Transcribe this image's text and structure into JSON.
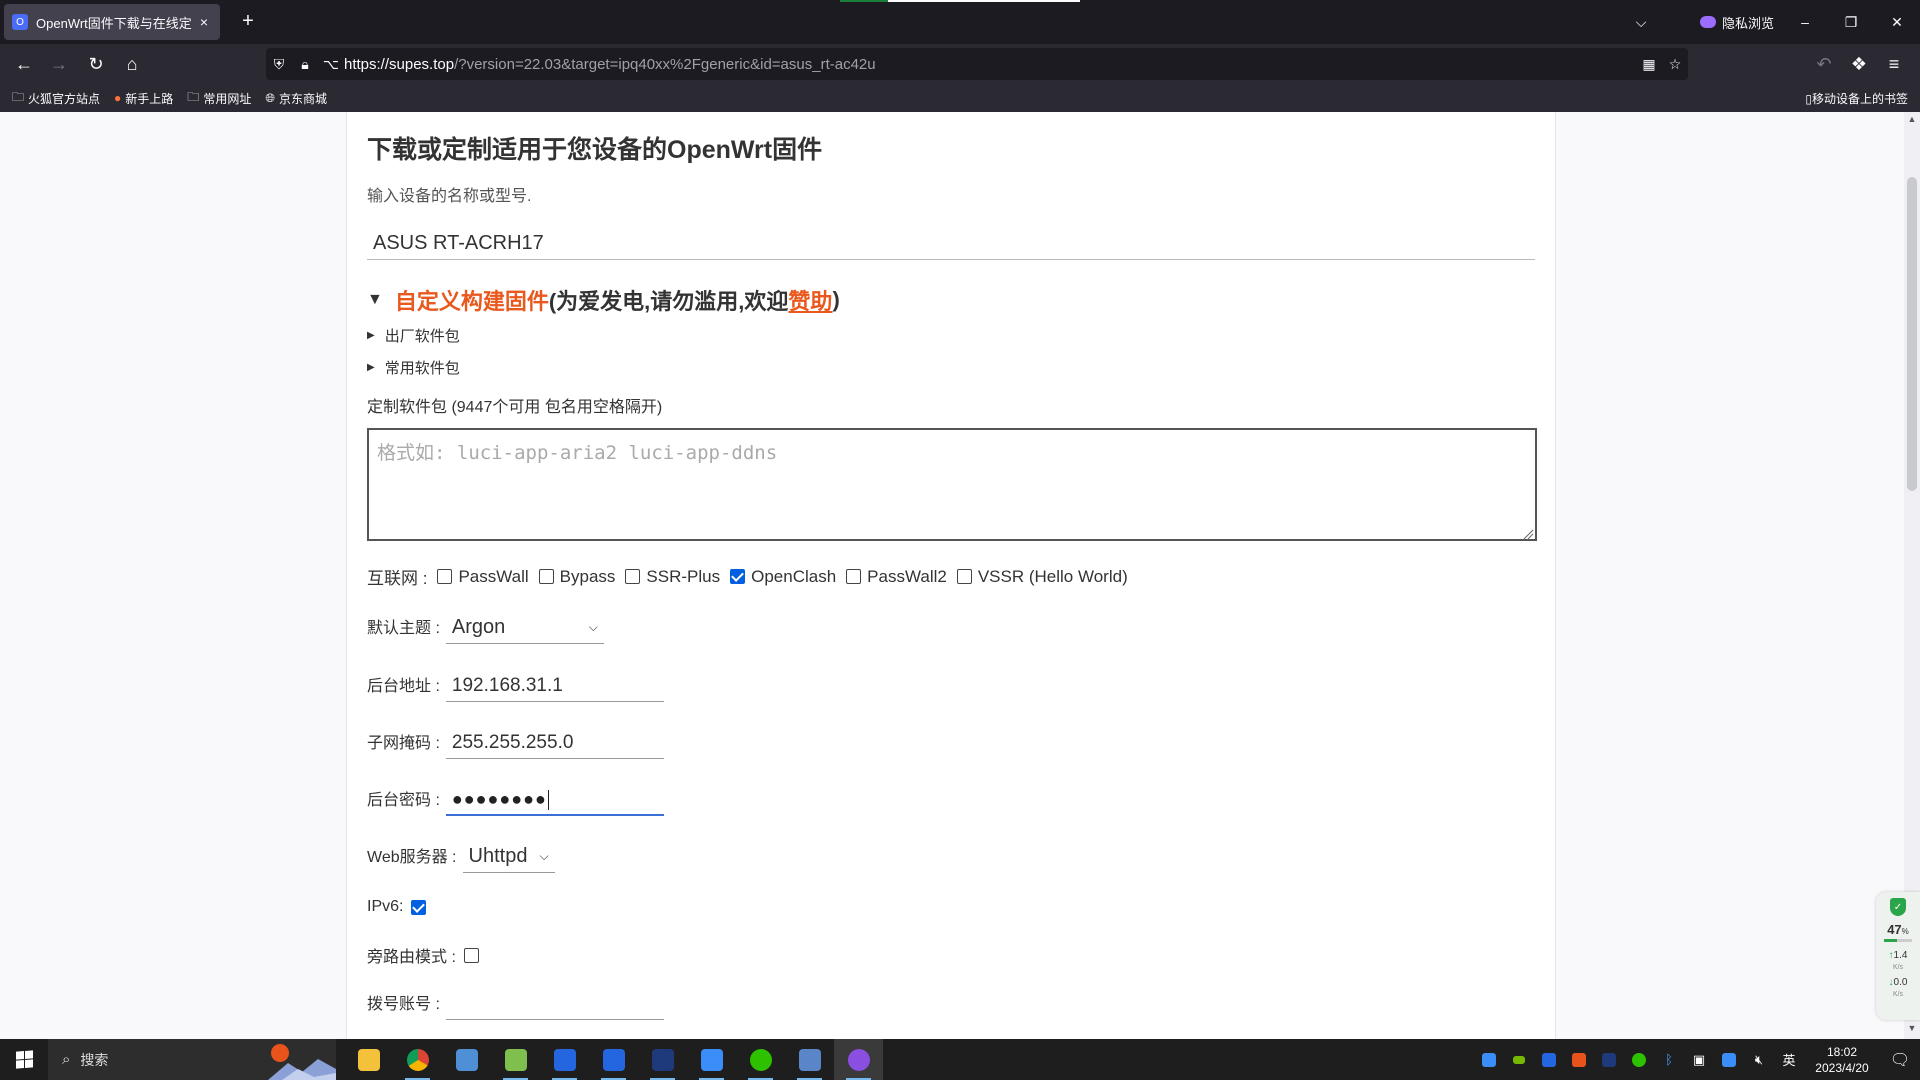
{
  "browser": {
    "tab_title": "OpenWrt固件下载与在线定制编",
    "tab_close": "×",
    "new_tab": "+",
    "private_label": "隐私浏览",
    "url_host": "https://supes.top",
    "url_rest": "/?version=22.03&target=ipq40xx%2Fgeneric&id=asus_rt-ac42u",
    "bookmarks": [
      "火狐官方站点",
      "新手上路",
      "常用网址",
      "京东商城"
    ],
    "mobile_bookmarks": "移动设备上的书签"
  },
  "page": {
    "heading": "下载或定制适用于您设备的OpenWrt固件",
    "hint": "输入设备的名称或型号.",
    "device_value": "ASUS RT-ACRH17",
    "custom_title": "自定义构建固件",
    "custom_note_open": " (为爱发电,请勿滥用,欢迎 ",
    "sponsor": "赞助",
    "custom_note_close": ")",
    "factory_packages": "出厂软件包",
    "common_packages": "常用软件包",
    "pkg_label": "定制软件包 (9447个可用 包名用空格隔开)",
    "pkg_placeholder": "格式如: luci-app-aria2 luci-app-ddns",
    "internet_label": "互联网 :",
    "internet_options": [
      {
        "label": "PassWall",
        "checked": false
      },
      {
        "label": "Bypass",
        "checked": false
      },
      {
        "label": "SSR-Plus",
        "checked": false
      },
      {
        "label": "OpenClash",
        "checked": true
      },
      {
        "label": "PassWall2",
        "checked": false
      },
      {
        "label": "VSSR (Hello World)",
        "checked": false
      }
    ],
    "theme_label": "默认主题 :",
    "theme_value": "Argon",
    "lan_ip_label": "后台地址 :",
    "lan_ip_value": "192.168.31.1",
    "netmask_label": "子网掩码 :",
    "netmask_value": "255.255.255.0",
    "password_label": "后台密码 :",
    "password_value": "●●●●●●●●",
    "webserver_label": "Web服务器 :",
    "webserver_value": "Uhttpd",
    "ipv6_label": "IPv6:",
    "ipv6_checked": true,
    "bypass_label": "旁路由模式 :",
    "bypass_checked": false,
    "pppoe_label": "拨号账号 :"
  },
  "monitor": {
    "percent": "47",
    "percent_unit": "%",
    "cpu_fraction": 0.47,
    "up": "1.4",
    "down": "0.0",
    "unit": "K/s"
  },
  "taskbar": {
    "search_text": "搜索",
    "ime": "英",
    "time": "18:02",
    "date": "2023/4/20"
  }
}
